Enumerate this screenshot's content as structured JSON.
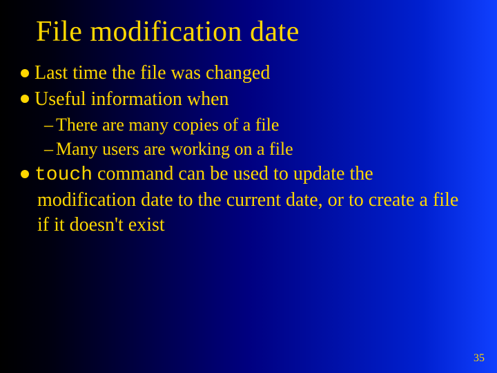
{
  "title": "File modification date",
  "b1_1": "Last time the file was changed",
  "b1_2": "Useful information when",
  "s1": "There are many copies of a file",
  "s2": "Many users are working on a file",
  "b1_3_code": "touch",
  "b1_3_rest": " command can be used to update the modification date to the current date, or to create a file if it doesn't exist",
  "pagenum": "35"
}
